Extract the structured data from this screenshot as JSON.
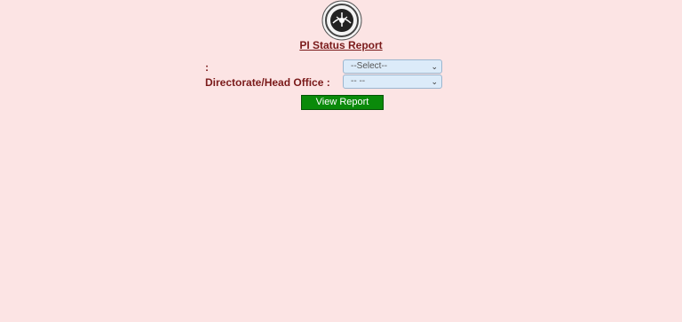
{
  "header": {
    "title": "PI Status Report"
  },
  "form": {
    "row1_label": ":",
    "row1_select_value": "--Select--",
    "row2_label": "Directorate/Head Office :",
    "row2_select_value": "-- --",
    "submit_label": "View Report"
  },
  "icons": {
    "emblem": "state-emblem-icon",
    "dropdown": "chevron-down-icon"
  },
  "colors": {
    "background": "#fce4e4",
    "label_text": "#7a1a1a",
    "button": "#0a8a0a",
    "select_bg": "#dcebf9"
  }
}
